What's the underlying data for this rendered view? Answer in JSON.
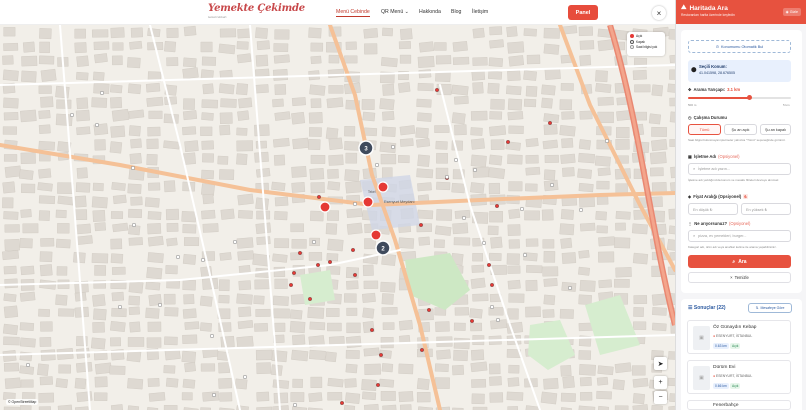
{
  "header": {
    "logo_text": "Yemekte Çekimde",
    "logo_sub": "lezzet rehberi",
    "nav": [
      {
        "label": "Menü Cebinde",
        "active": true
      },
      {
        "label": "QR Menü",
        "active": false
      },
      {
        "label": "Hakkında",
        "active": false
      },
      {
        "label": "Blog",
        "active": false
      },
      {
        "label": "İletişim",
        "active": false
      }
    ],
    "panel_button": "Panel",
    "close_symbol": "×"
  },
  "map": {
    "legend": [
      {
        "label": "Açık",
        "color": "#e53935"
      },
      {
        "label": "Kapalı",
        "color": "#ffffff"
      },
      {
        "label": "Saat bilgisi yok",
        "color": "#ffffff"
      }
    ],
    "clusters": [
      "3",
      "2"
    ],
    "zoom_in": "+",
    "zoom_out": "−",
    "attribution": "© OpenStreetMap",
    "road_labels": [
      "Esenyurt Meydanı",
      "Tekel"
    ]
  },
  "sidebar": {
    "title": "Haritada Ara",
    "subtitle": "Restoranları harita üzerinde keşfedin",
    "hide_button": "Gizle",
    "locate_button": "Konumumu Otomatik Bul",
    "selected_location_label": "Seçili Konum:",
    "selected_location_value": "41.041598, 28.676505",
    "radius_label": "Arama Yarıçapı:",
    "radius_value": "3.1 km",
    "radius_min": "500 m",
    "radius_max": "5 km",
    "radius_fraction": 0.6,
    "status_label": "Çalışma Durumu",
    "status_options": [
      "Tümü",
      "Şu an açık",
      "Şu an kapalı"
    ],
    "status_help": "Saat bilgisi bulunmayan işletmeler yalnızca \"Tümü\" seçeneğinde görünür.",
    "name_label": "İşletme Adı",
    "name_optional": "(Opsiyonel)",
    "name_placeholder": "İşletme adı yazın...",
    "name_help": "İşletme adı yazdığınızda konum ve mesafe filtreleri devreye alınmaz.",
    "price_label": "Fiyat Aralığı (Opsiyonel)",
    "price_badge": "₺",
    "price_min_placeholder": "En düşük ₺",
    "price_max_placeholder": "En yüksek ₺",
    "query_label": "Ne arıyorsunuz?",
    "query_optional": "(Opsiyonel)",
    "query_placeholder": "pizza, ev yemekleri, burger...",
    "query_help": "Kategori adı, ürün adı veya anahtar kelime ile arama yapabilirsiniz.",
    "search_button": "Ara",
    "clear_button": "Temizle",
    "results_label": "Sonuçlar (22)",
    "sort_button": "Mesafeye Göre",
    "results": [
      {
        "name": "Öz Günaydın Kebap",
        "location": "ESENYURT, İSTANBUL",
        "distance": "0.63 km",
        "status": "Açık"
      },
      {
        "name": "Dürüm Evi",
        "location": "ESENYURT, İSTANBUL",
        "distance": "0.66 km",
        "status": "Açık"
      },
      {
        "name": "Fenerbahçe",
        "location": "",
        "distance": "",
        "status": ""
      }
    ]
  },
  "colors": {
    "accent": "#e7523f",
    "open": "#e53935",
    "cluster": "#3f4a5c"
  }
}
